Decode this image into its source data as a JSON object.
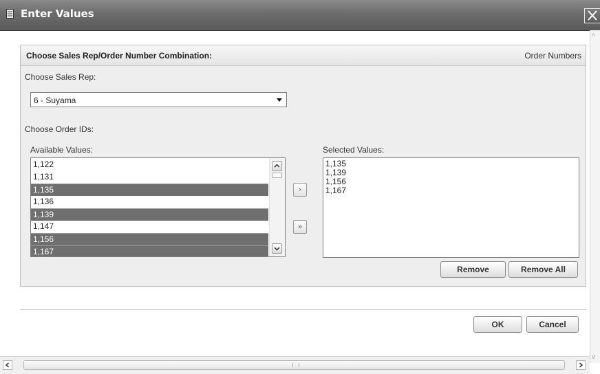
{
  "window": {
    "title": "Enter Values"
  },
  "panel": {
    "title": "Choose Sales Rep/Order Number Combination:",
    "right_label": "Order Numbers"
  },
  "sales_rep": {
    "label": "Choose Sales Rep:",
    "selected": "6 - Suyama"
  },
  "order_ids": {
    "label": "Choose Order IDs:",
    "available_label": "Available Values:",
    "selected_label": "Selected Values:",
    "available": [
      {
        "value": "1,122",
        "selected": false
      },
      {
        "value": "1,131",
        "selected": false
      },
      {
        "value": "1,135",
        "selected": true
      },
      {
        "value": "1,136",
        "selected": false
      },
      {
        "value": "1,139",
        "selected": true
      },
      {
        "value": "1,147",
        "selected": false
      },
      {
        "value": "1,156",
        "selected": true
      },
      {
        "value": "1,167",
        "selected": true
      }
    ],
    "selected_values": [
      "1,135",
      "1,139",
      "1,156",
      "1,167"
    ]
  },
  "buttons": {
    "move_selected": "›",
    "move_all": "»",
    "remove": "Remove",
    "remove_all": "Remove All",
    "ok": "OK",
    "cancel": "Cancel"
  },
  "colors": {
    "titlebar": "#6c6c6c",
    "selection": "#6f6f6f",
    "panel_bg": "#eeeeee"
  }
}
